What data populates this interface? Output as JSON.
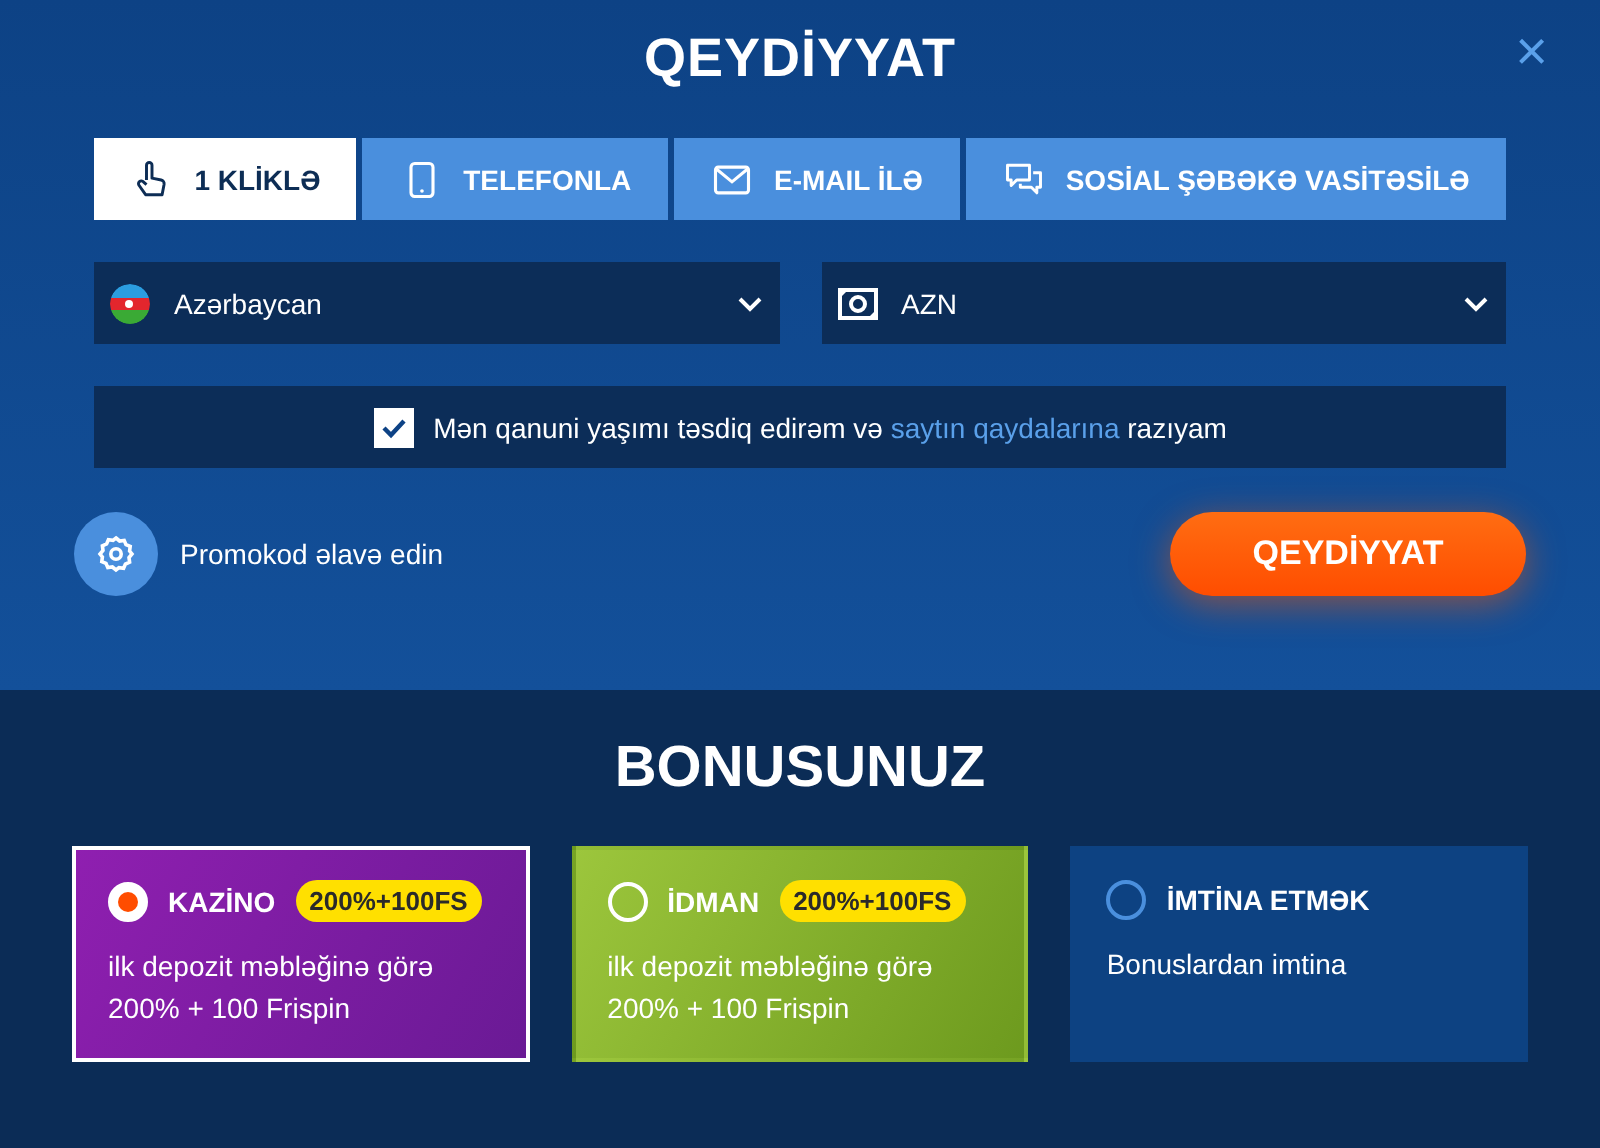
{
  "title": "QEYDİYYAT",
  "close": "×",
  "tabs": [
    {
      "kind": "click",
      "label": "1 KLİKLƏ",
      "selected": true
    },
    {
      "kind": "phone",
      "label": "TELEFONLA",
      "selected": false
    },
    {
      "kind": "email",
      "label": "E-MAIL İLƏ",
      "selected": false
    },
    {
      "kind": "social",
      "label": "SOSİAL ŞƏBƏKƏ VASİTƏSİLƏ",
      "selected": false
    }
  ],
  "selects": [
    {
      "kind": "country",
      "value": "Azərbaycan"
    },
    {
      "kind": "currency",
      "value": "AZN"
    }
  ],
  "agreement": {
    "checked": true,
    "text_before": "Mən qanuni yaşımı təsdiq edirəm və",
    "link": "saytın qaydalarına",
    "text_after": "razıyam"
  },
  "promo": {
    "label": "Promokod əlavə edin"
  },
  "submit": "QEYDİYYAT",
  "bonus": {
    "title": "BONUSUNUZ",
    "options": [
      {
        "kind": "casino",
        "title": "KAZİNO",
        "badge": "200%+100FS",
        "description": "ilk depozit məbləğinə görə 200% + 100 Frispin",
        "selected": true
      },
      {
        "kind": "sport",
        "title": "İDMAN",
        "badge": "200%+100FS",
        "description": "ilk depozit məbləğinə görə 200% + 100 Frispin",
        "selected": false
      },
      {
        "kind": "none",
        "title": "İMTİNA ETMƏK",
        "description": "Bonuslardan imtina",
        "selected": false
      }
    ]
  }
}
